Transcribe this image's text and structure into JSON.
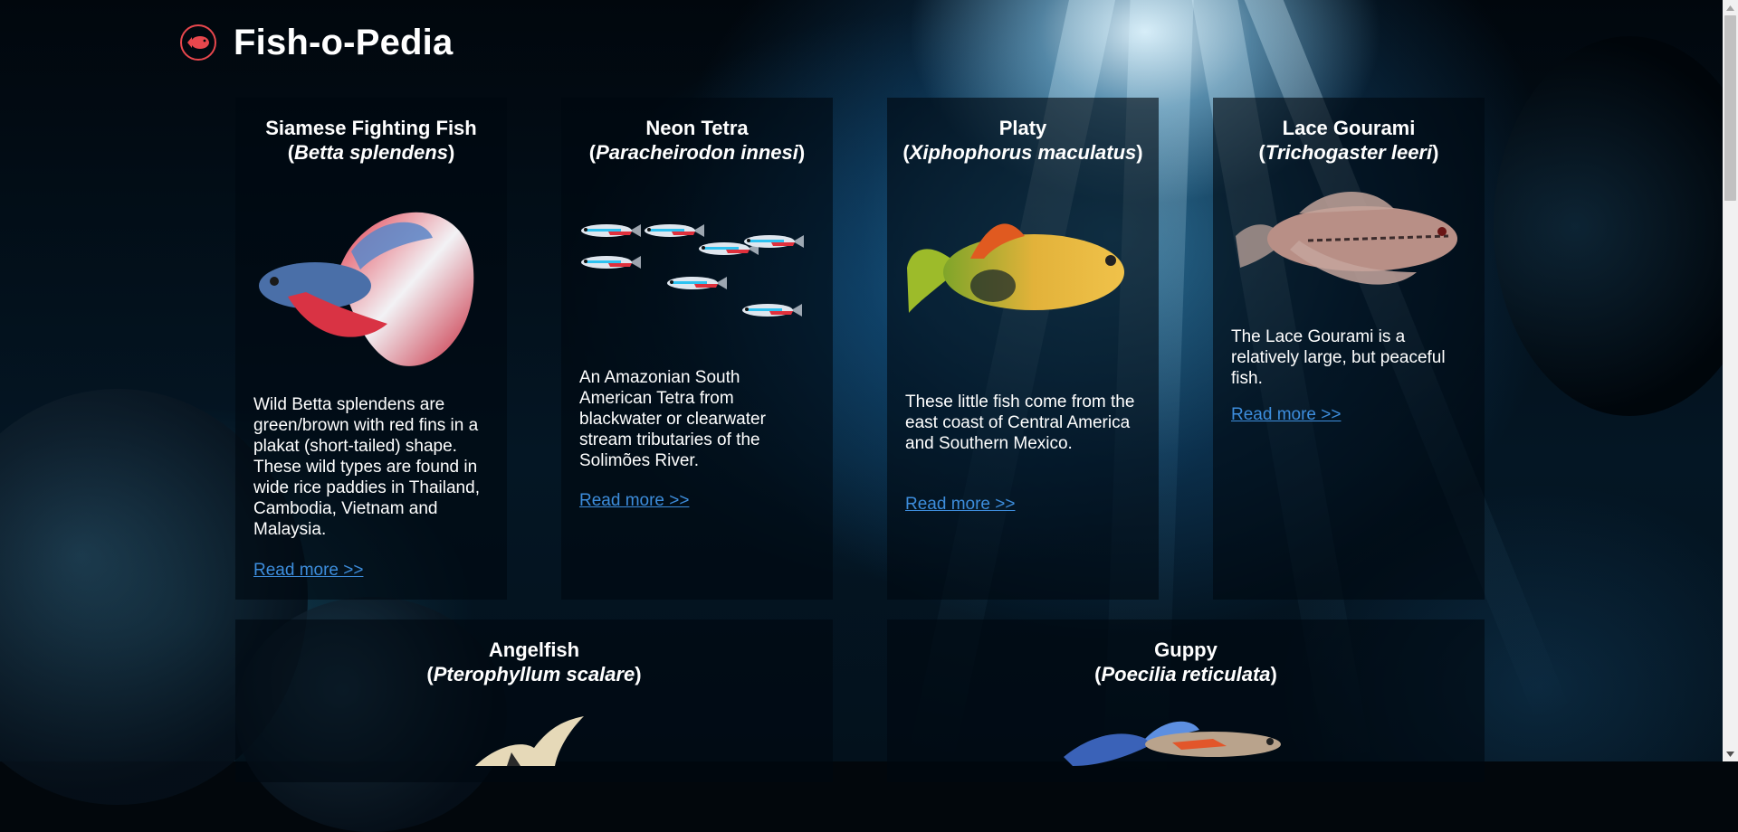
{
  "site": {
    "title": "Fish-o-Pedia",
    "logo_icon": "fish-logo-icon",
    "accent": "#e8474d"
  },
  "read_more_label": "Read more >>",
  "link_color": "#3d8ddc",
  "cards": [
    {
      "common_name": "Siamese Fighting Fish",
      "scientific_name": "Betta splendens",
      "image": "betta-fish-image",
      "description": "Wild Betta splendens are green/brown with red fins in a plakat (short-tailed) shape. These wild types are found in wide rice paddies in Thailand, Cambodia, Vietnam and Malaysia."
    },
    {
      "common_name": "Neon Tetra",
      "scientific_name": "Paracheirodon innesi",
      "image": "neon-tetra-image",
      "description": "An Amazonian South American Tetra from blackwater or clearwater stream tributaries of the Solimões River."
    },
    {
      "common_name": "Platy",
      "scientific_name": "Xiphophorus maculatus",
      "image": "platy-fish-image",
      "description": "These little fish come from the east coast of Central America and Southern Mexico."
    },
    {
      "common_name": "Lace Gourami",
      "scientific_name": "Trichogaster leeri",
      "image": "lace-gourami-image",
      "description": "The Lace Gourami is a relatively large, but peaceful fish."
    },
    {
      "common_name": "Angelfish",
      "scientific_name": "Pterophyllum scalare",
      "image": "angelfish-image"
    },
    {
      "common_name": "Guppy",
      "scientific_name": "Poecilia reticulata",
      "image": "guppy-image"
    }
  ]
}
